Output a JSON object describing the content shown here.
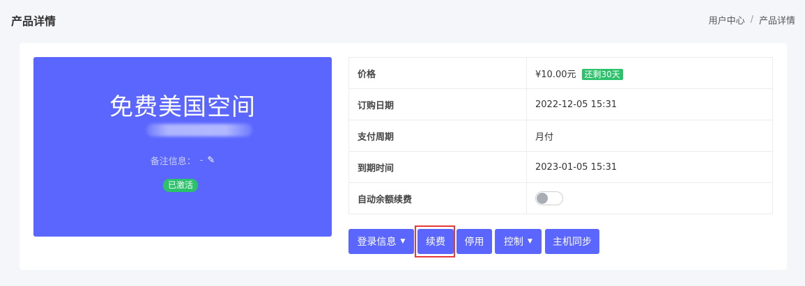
{
  "page": {
    "title": "产品详情"
  },
  "breadcrumb": {
    "items": [
      "用户中心",
      "产品详情"
    ],
    "separator": "/"
  },
  "product": {
    "name": "免费美国空间",
    "remark_label": "备注信息：",
    "remark_value": "-",
    "status": "已激活"
  },
  "details": {
    "price_label": "价格",
    "price_value": "¥10.00元",
    "days_left": "还剩30天",
    "order_date_label": "订购日期",
    "order_date_value": "2022-12-05 15:31",
    "billing_cycle_label": "支付周期",
    "billing_cycle_value": "月付",
    "expiry_label": "到期时间",
    "expiry_value": "2023-01-05 15:31",
    "auto_renew_label": "自动余额续费",
    "auto_renew_enabled": false
  },
  "actions": {
    "login_info": "登录信息",
    "renew": "续费",
    "disable": "停用",
    "control": "控制",
    "host_sync": "主机同步"
  },
  "colors": {
    "primary": "#5b66ff",
    "success": "#2cc16b",
    "highlight": "#e63a3a"
  }
}
